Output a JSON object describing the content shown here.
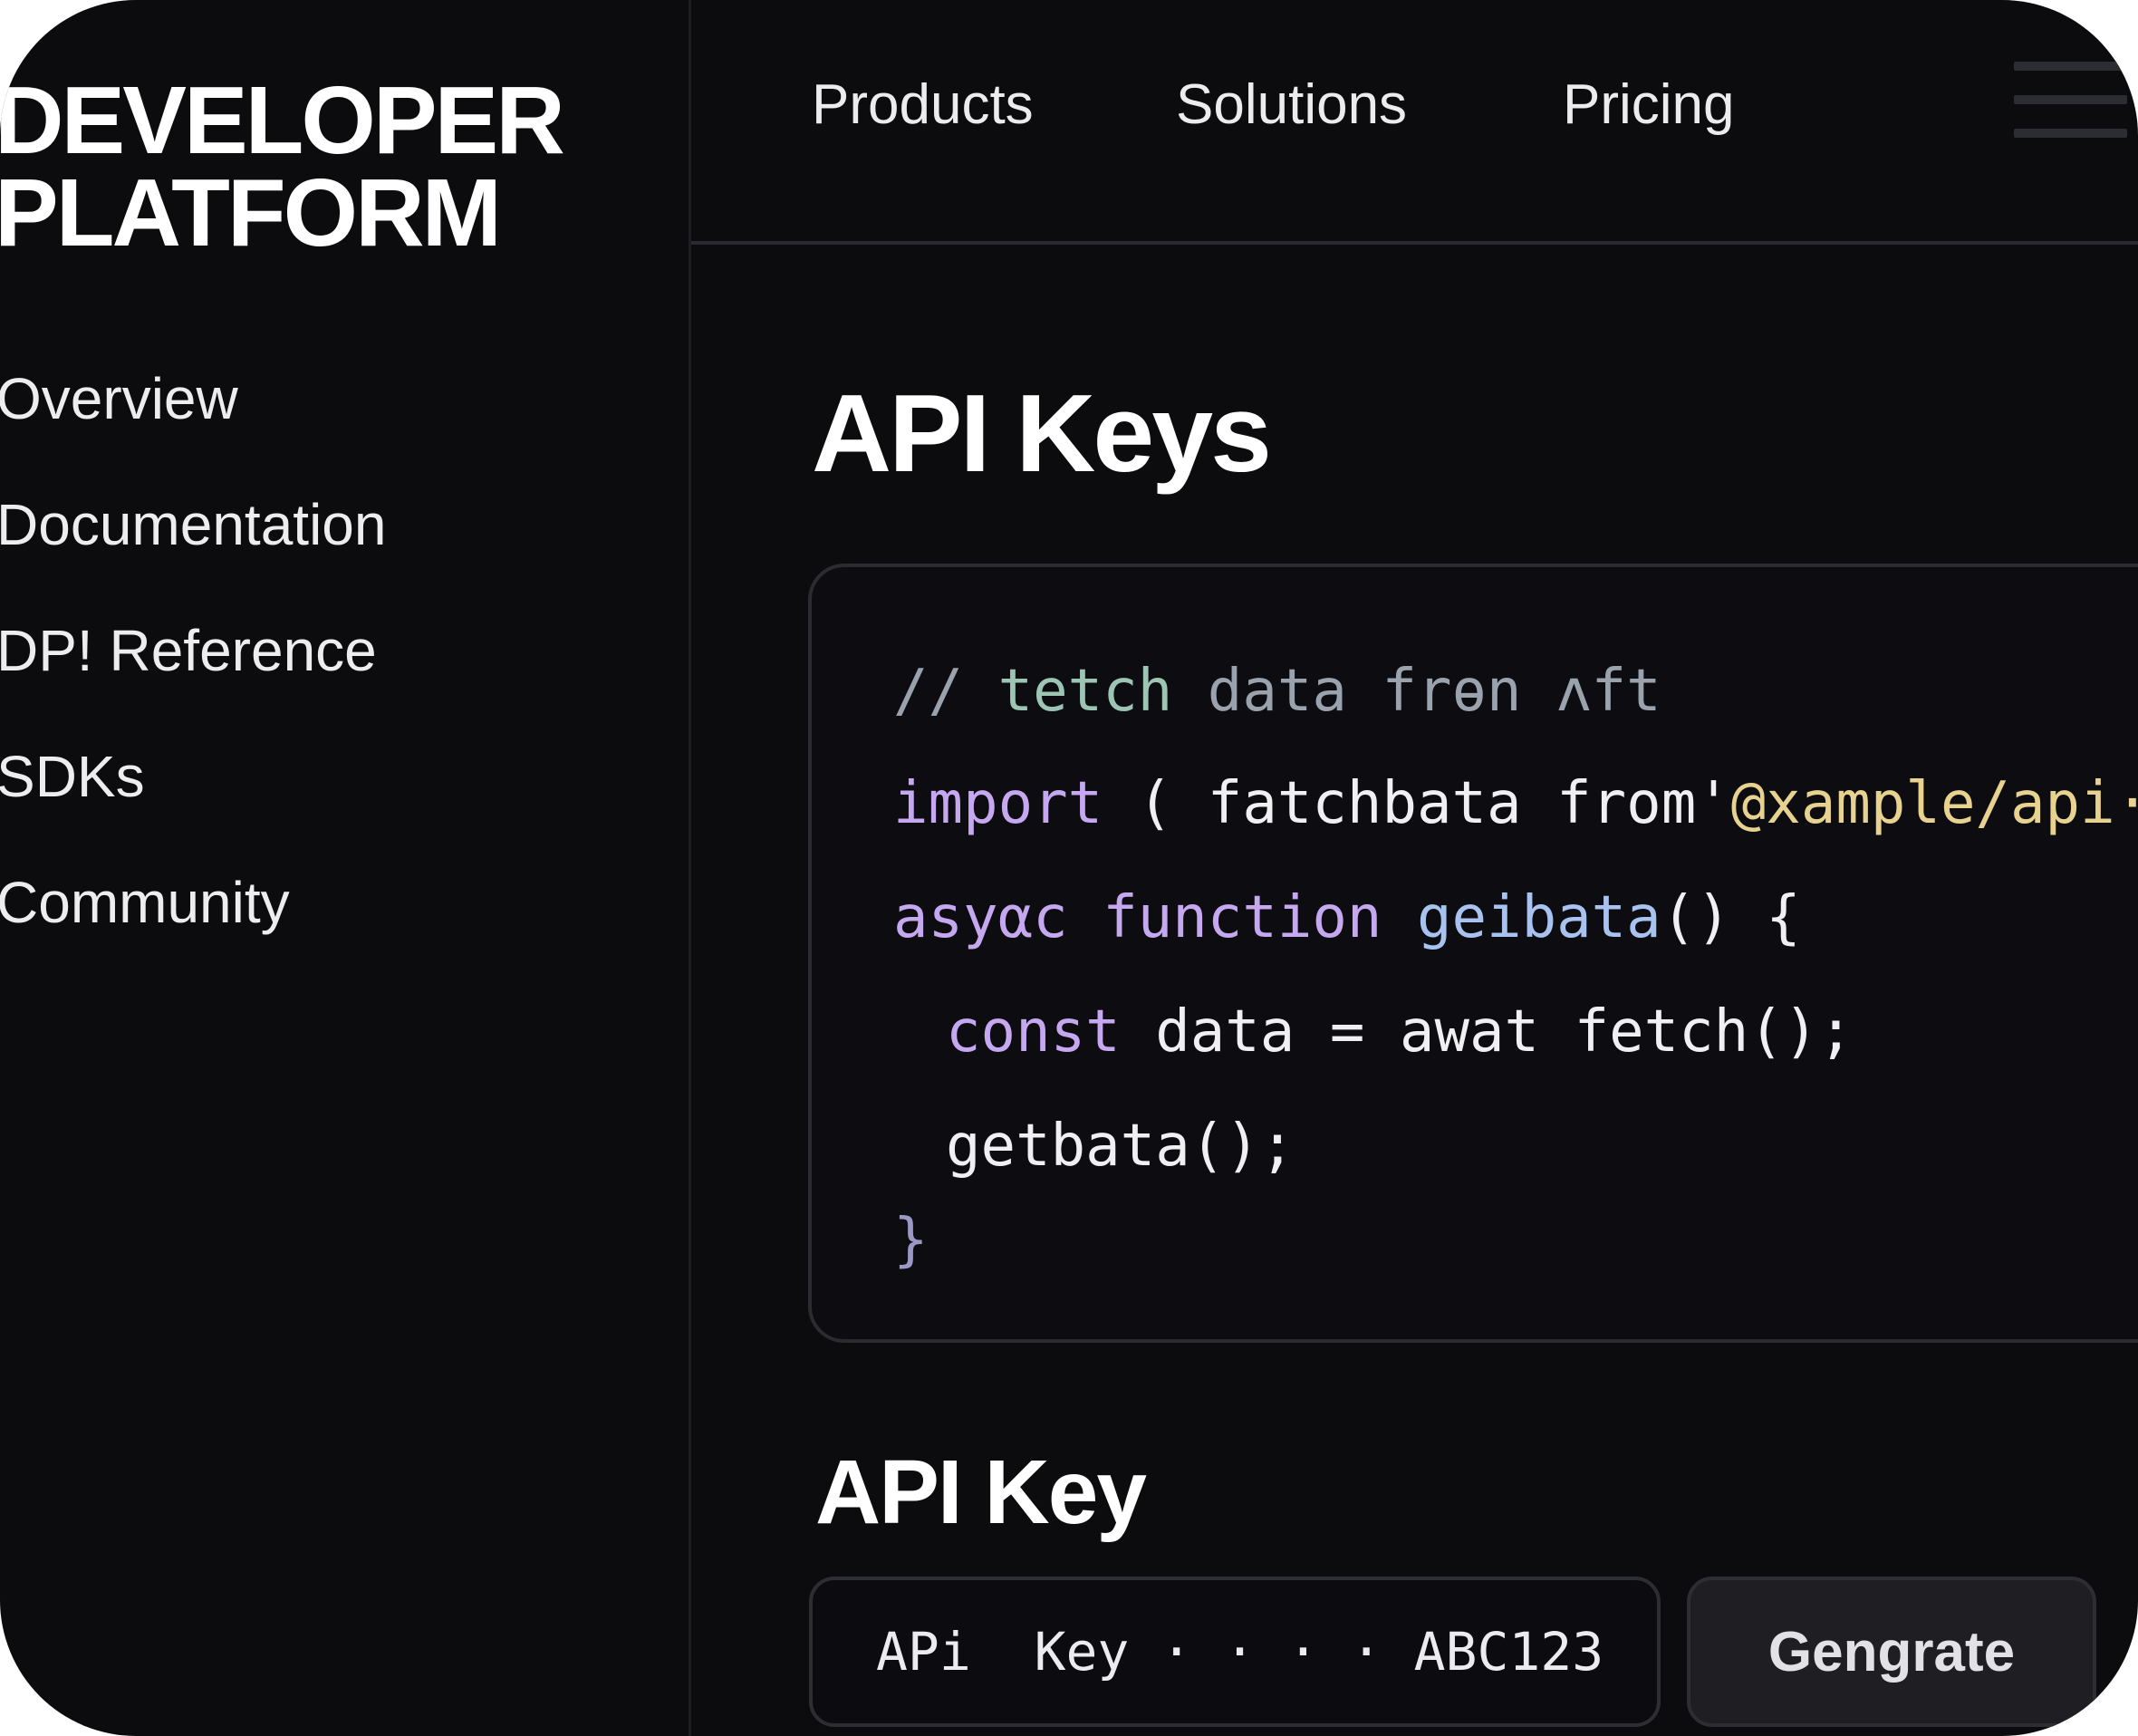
{
  "sidebar": {
    "brand_line1": "DEVELOPER",
    "brand_line2": "PLATFORM",
    "items": [
      {
        "label": "Overview"
      },
      {
        "label": "Documentation"
      },
      {
        "label": "DP! Reference"
      },
      {
        "label": "SDKs"
      },
      {
        "label": "Community"
      }
    ]
  },
  "topnav": {
    "items": [
      {
        "label": "Products"
      },
      {
        "label": "Solutions"
      },
      {
        "label": "Pricing"
      }
    ],
    "menu_icon": "hamburger-menu-icon"
  },
  "main": {
    "title": "API Keys",
    "code": {
      "comment_a": "// ",
      "comment_b": "tetch",
      "comment_c": " data frөn ʌft",
      "line2_kw": "import",
      "line2_plain": " ( fatchbata from'",
      "line2_str": "@xample/api·:",
      "line3_kw": "asyαc function",
      "line3_fn": " geibata",
      "line3_plain": "() {",
      "line4_kw": "const",
      "line4_plain": " data = awat fetch();",
      "line5_plain": "getbata();",
      "line6_brace": "}"
    },
    "key_section_title": "API Key",
    "key_field_value": "APi  Key · · · · ABC123",
    "generate_label": "Gengrate"
  },
  "colors": {
    "background": "#0c0c0f",
    "keyword": "#c6a8f0",
    "string": "#e8d28f",
    "function": "#a9c3f0",
    "comment": "#9aa3ad"
  }
}
